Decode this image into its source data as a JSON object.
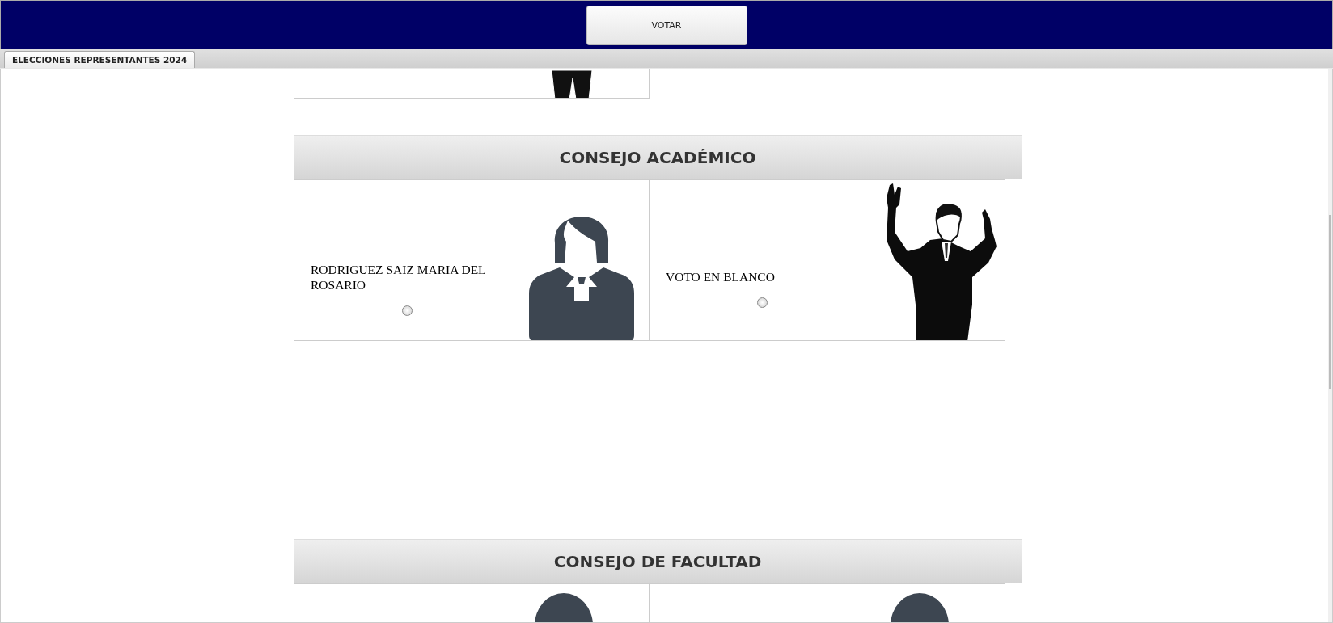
{
  "toolbar": {
    "vote_button": "VOTAR"
  },
  "tabs": [
    {
      "label": "ELECCIONES REPRESENTANTES 2024",
      "selected": true
    }
  ],
  "sections": [
    {
      "cards": [
        {
          "kind": "blank"
        }
      ]
    },
    {
      "title": "CONSEJO ACADÉMICO",
      "cards": [
        {
          "kind": "candidate_woman",
          "name": "RODRIGUEZ SAIZ MARIA DEL ROSARIO",
          "selected": false
        },
        {
          "kind": "blank",
          "name": "VOTO EN BLANCO",
          "selected": false
        }
      ]
    },
    {
      "title": "CONSEJO DE FACULTAD",
      "cards": [
        {
          "kind": "candidate_man"
        },
        {
          "kind": "candidate_man"
        }
      ]
    }
  ]
}
